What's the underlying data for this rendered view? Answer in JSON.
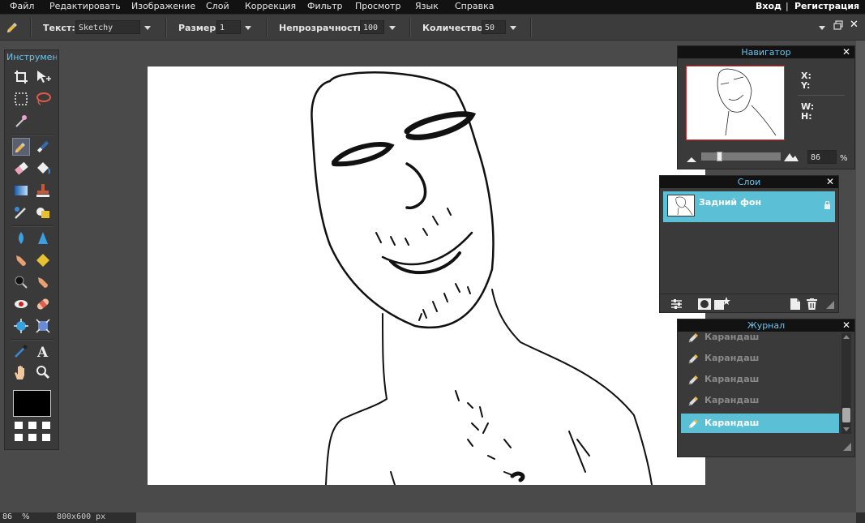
{
  "menu": {
    "items": [
      "Файл",
      "Редактировать",
      "Изображение",
      "Слой",
      "Коррекция",
      "Фильтр",
      "Просмотр",
      "Язык",
      "Справка"
    ],
    "login": "Вход",
    "divider": "|",
    "register": "Регистрация"
  },
  "options": {
    "text_label": "Текст:",
    "text_value": "Sketchy",
    "size_label": "Размер:",
    "size_value": "1",
    "opacity_label": "Непрозрачность:",
    "opacity_value": "100",
    "count_label": "Количество:",
    "count_value": "50"
  },
  "toolbox": {
    "title": "Инструмент",
    "tools": [
      "crop-icon",
      "move-icon",
      "marquee-icon",
      "lasso-icon",
      "magic-wand-icon",
      "pencil-icon",
      "brush-icon",
      "eraser-icon",
      "paint-bucket-icon",
      "gradient-icon",
      "clone-stamp-icon",
      "color-replace-icon",
      "shape-icon",
      "blur-icon",
      "sharpen-icon",
      "smudge-icon",
      "sponge-icon",
      "burn-icon",
      "dodge-icon",
      "red-eye-icon",
      "healing-icon",
      "bloat-icon",
      "pinch-icon",
      "color-picker-icon",
      "type-icon",
      "hand-icon",
      "zoom-icon"
    ],
    "foreground_color": "#000000",
    "background_color": "#ffffff"
  },
  "navigator": {
    "title": "Навигатор",
    "x_label": "X:",
    "y_label": "Y:",
    "w_label": "W:",
    "h_label": "H:",
    "zoom_value": "86",
    "zoom_unit": "%",
    "zoom_slider_fraction": 0.22
  },
  "layers": {
    "title": "Слои",
    "items": [
      {
        "name": "Задний фон",
        "locked": true,
        "selected": true
      }
    ]
  },
  "history": {
    "title": "Журнал",
    "items": [
      {
        "label": "Карандаш",
        "selected": false
      },
      {
        "label": "Карандаш",
        "selected": false
      },
      {
        "label": "Карандаш",
        "selected": false
      },
      {
        "label": "Карандаш",
        "selected": false
      },
      {
        "label": "Карандаш",
        "selected": true
      }
    ]
  },
  "status": {
    "zoom": "86",
    "zoom_unit": "%",
    "dimensions": "800x600 px"
  },
  "colors": {
    "accent": "#6cc4ee",
    "selection": "#5bbfd6",
    "menubar": "#121212"
  }
}
